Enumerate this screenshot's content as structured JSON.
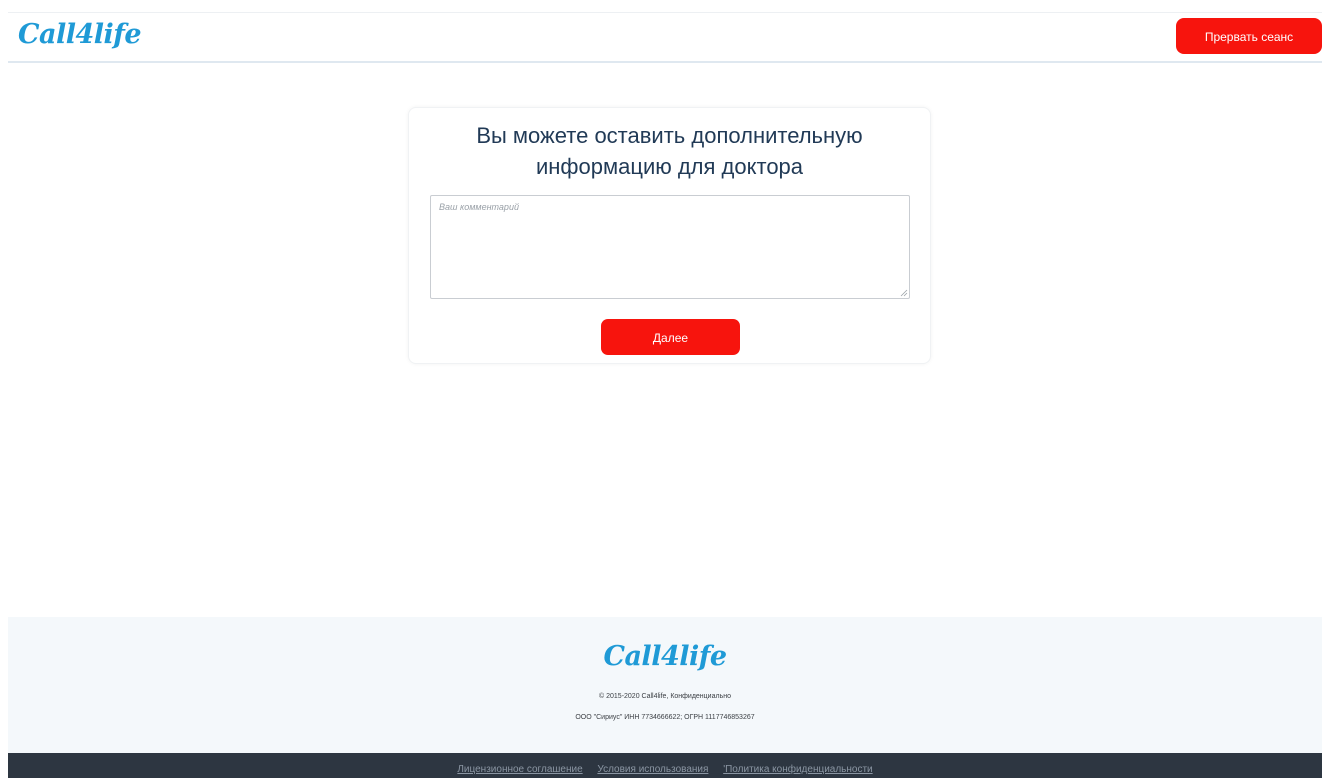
{
  "header": {
    "logo_text": "Call4life",
    "end_session_label": "Прервать сеанс"
  },
  "card": {
    "title_line1": "Вы можете оставить дополнительную",
    "title_line2": "информацию для доктора",
    "comment_placeholder": "Ваш комментарий",
    "comment_value": "",
    "next_label": "Далее"
  },
  "footer": {
    "logo_text": "Call4life",
    "copyright": "© 2015-2020 Call4life, Конфиденциально",
    "legal": "ООО \"Сириус\" ИНН 7734666622; ОГРН 1117746853267"
  },
  "bottom_links": {
    "license": "Лицензионное соглашение",
    "terms": "Условия использования",
    "privacy": "'Политика конфиденциальности"
  },
  "colors": {
    "accent_red": "#f7140d",
    "brand_blue": "#1f9ad6",
    "title_navy": "#213a56",
    "bottom_bar": "#2d3641"
  }
}
